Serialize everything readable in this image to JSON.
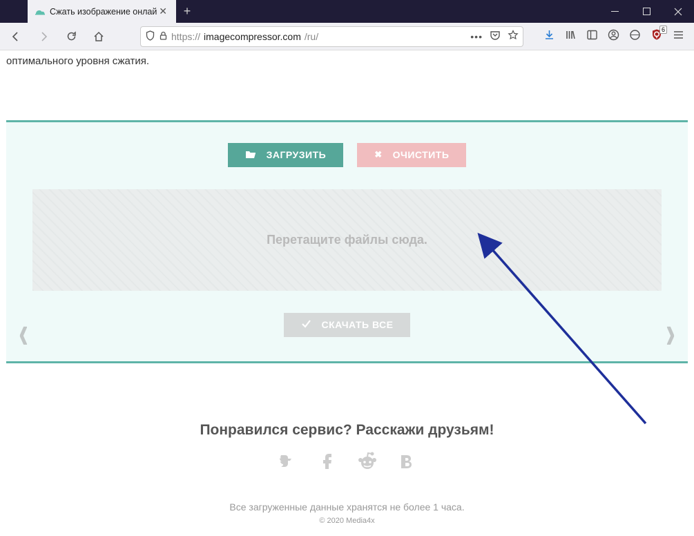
{
  "window": {
    "tab_title": "Сжать изображение онлайн",
    "url_prefix": "https://",
    "url_domain": "imagecompressor.com",
    "url_path": "/ru/"
  },
  "toolbar_icons": {
    "back": "back-icon",
    "forward": "forward-icon",
    "reload": "reload-icon",
    "home": "home-icon",
    "shield": "shield-icon",
    "lock": "lock-icon",
    "dots": "more-icon",
    "pocket": "pocket-icon",
    "star": "bookmark-star-icon",
    "download": "download-icon",
    "library": "library-icon",
    "sidebar": "sidebar-icon",
    "account": "account-icon",
    "refresh2": "sync-icon",
    "ublock": "ublock-icon",
    "ublock_badge": "6",
    "menu": "menu-icon"
  },
  "page": {
    "intro_fragment": "оптимального уровня сжатия.",
    "upload_label": "ЗАГРУЗИТЬ",
    "clear_label": "ОЧИСТИТЬ",
    "dropzone_text": "Перетащите файлы сюда.",
    "download_all_label": "СКАЧАТЬ ВСЕ",
    "share_title": "Понравился сервис? Расскажи друзьям!",
    "retention_notice": "Все загруженные данные хранятся не более 1 часа.",
    "copyright": "© 2020 Media4x"
  }
}
